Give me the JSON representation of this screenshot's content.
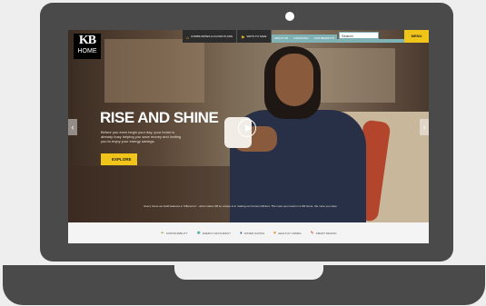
{
  "brand": {
    "logo_kb": "KB",
    "logo_home": "HOME"
  },
  "nav": {
    "items": [
      {
        "label": "COMMUNITIES & FLOOR PLANS",
        "icon": "home-icon"
      },
      {
        "label": "WAYS TO SAVE",
        "icon": "tag-icon"
      }
    ],
    "secondary": [
      "ABOUT KB",
      "FINANCING",
      "OUR BENEFITS"
    ],
    "search_placeholder": "Search",
    "gold_tab": "MENU"
  },
  "hero": {
    "headline": "RISE AND SHINE",
    "body": "Before you even begin your day, your home is already busy helping you save money and inviting you to enjoy your energy savings.",
    "cta_label": "EXPLORE",
    "caption": "Every home we build features a \"difference\" - what makes KB so unique is in making our homes efficient. The more you invest in a KB home, the more you save."
  },
  "footer": {
    "items": [
      {
        "label": "SUSTAINABILITY",
        "icon": "leaf-icon"
      },
      {
        "label": "ENERGY EFFICIENCY",
        "icon": "bulb-icon"
      },
      {
        "label": "WATER SAVING",
        "icon": "drop-icon"
      },
      {
        "label": "HEALTHY HOMES",
        "icon": "heart-icon"
      },
      {
        "label": "SMART DESIGN",
        "icon": "pencil-icon"
      }
    ]
  },
  "colors": {
    "accent": "#f0c419",
    "teal": "#7fb2b5",
    "frame": "#4a4a4a"
  }
}
